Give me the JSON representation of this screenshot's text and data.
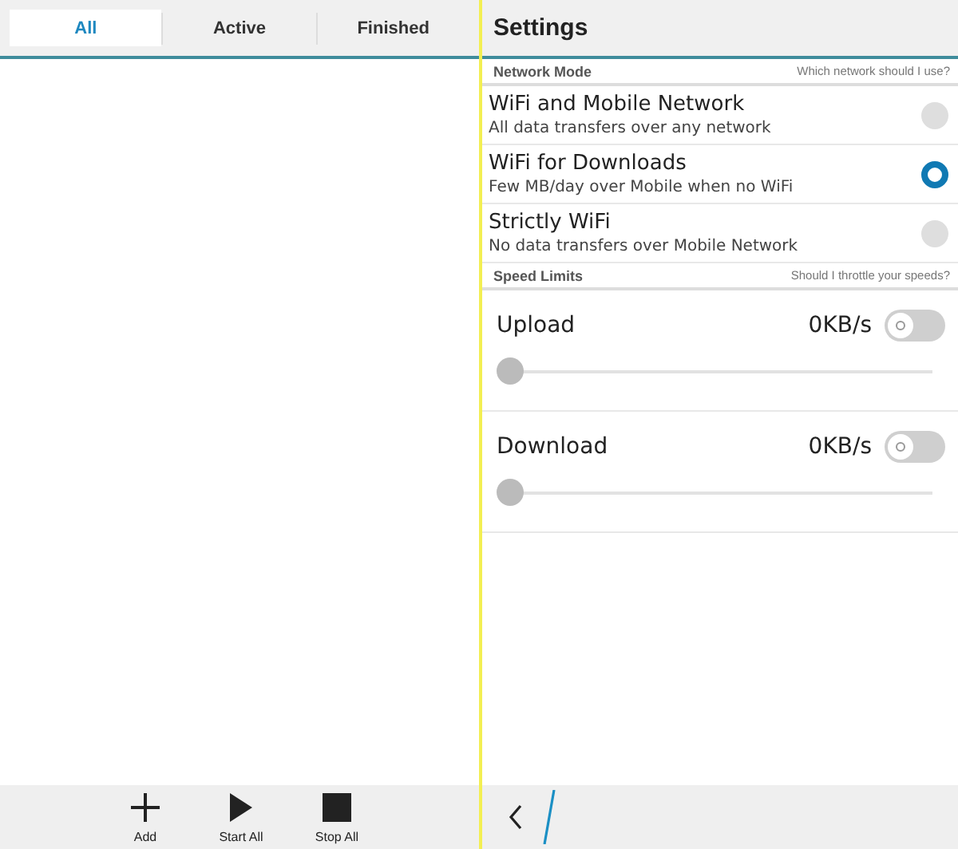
{
  "tabs": [
    {
      "label": "All",
      "selected": true
    },
    {
      "label": "Active",
      "selected": false
    },
    {
      "label": "Finished",
      "selected": false
    }
  ],
  "toolbar": [
    {
      "kind": "add",
      "label": "Add"
    },
    {
      "kind": "play",
      "label": "Start All"
    },
    {
      "kind": "stop",
      "label": "Stop All"
    }
  ],
  "settings": {
    "title": "Settings",
    "network_mode": {
      "title": "Network Mode",
      "hint": "Which network should I use?",
      "options": [
        {
          "label": "WiFi and Mobile Network",
          "description": "All data transfers over any network",
          "selected": false
        },
        {
          "label": "WiFi for Downloads",
          "description": "Few MB/day over Mobile when no WiFi",
          "selected": true
        },
        {
          "label": "Strictly WiFi",
          "description": "No data transfers over Mobile Network",
          "selected": false
        }
      ]
    },
    "speed_limits": {
      "title": "Speed Limits",
      "hint": "Should I throttle your speeds?",
      "items": [
        {
          "label": "Upload",
          "reading": "0KB/s",
          "on": false,
          "level": 0
        },
        {
          "label": "Download",
          "reading": "0KB/s",
          "on": false,
          "level": 0
        }
      ]
    }
  }
}
